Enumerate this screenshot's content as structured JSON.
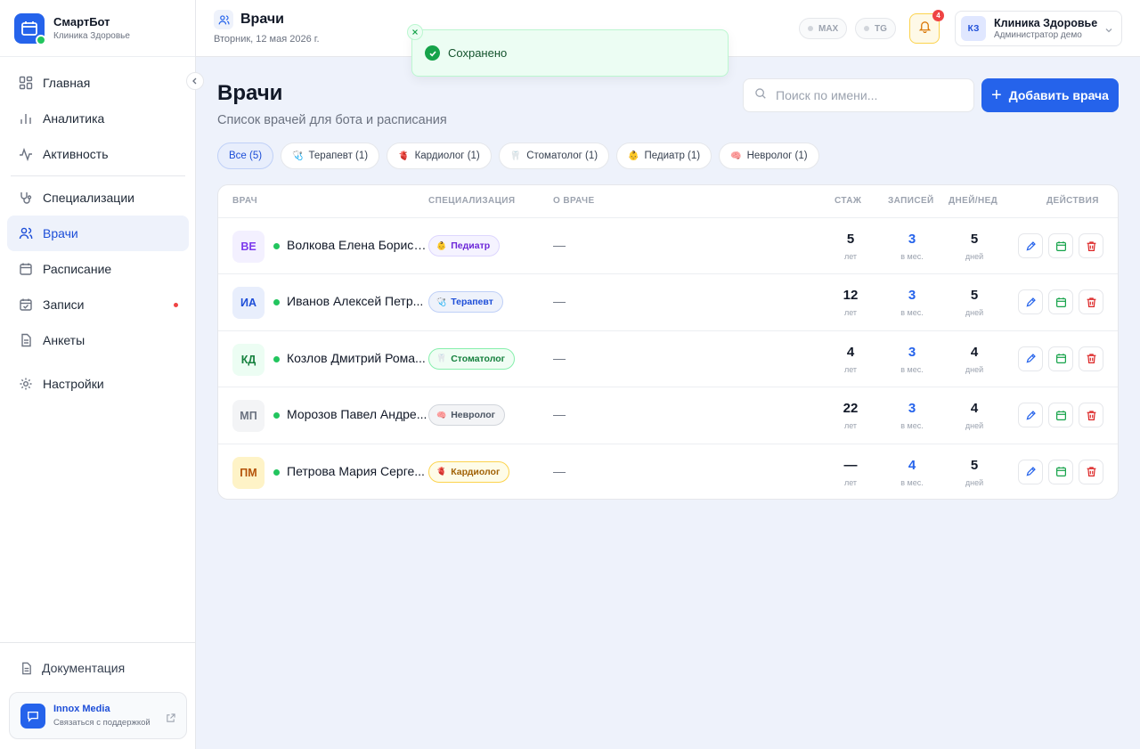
{
  "brand": {
    "name": "СмартБот",
    "subtitle": "Клиника Здоровье"
  },
  "nav": {
    "items": [
      {
        "label": "Главная",
        "icon": "grid-icon"
      },
      {
        "label": "Аналитика",
        "icon": "bar-chart-icon"
      },
      {
        "label": "Активность",
        "icon": "pulse-icon"
      },
      {
        "label": "Специализации",
        "icon": "stethoscope-icon"
      },
      {
        "label": "Врачи",
        "icon": "users-icon",
        "active": true
      },
      {
        "label": "Расписание",
        "icon": "calendar-icon"
      },
      {
        "label": "Записи",
        "icon": "calendar-check-icon",
        "has_dot": true
      },
      {
        "label": "Анкеты",
        "icon": "document-icon"
      },
      {
        "label": "Настройки",
        "icon": "gear-icon"
      }
    ],
    "docs_label": "Документация",
    "support": {
      "title": "Innox Media",
      "subtitle": "Связаться с поддержкой"
    }
  },
  "header": {
    "title": "Врачи",
    "date": "Вторник, 12 мая 2026 г.",
    "channels": [
      "MAX",
      "TG"
    ],
    "notifications_count": "4",
    "account": {
      "initials": "КЗ",
      "name": "Клиника Здоровье",
      "role": "Администратор демо"
    }
  },
  "toast": {
    "text": "Сохранено"
  },
  "page": {
    "title": "Врачи",
    "subtitle": "Список врачей для бота и расписания",
    "search_placeholder": "Поиск по имени...",
    "add_button": "Добавить врача"
  },
  "filters": [
    {
      "label": "Все (5)",
      "active": true,
      "emoji": ""
    },
    {
      "label": "Терапевт (1)",
      "emoji": "🩺"
    },
    {
      "label": "Кардиолог (1)",
      "emoji": "🫀"
    },
    {
      "label": "Стоматолог (1)",
      "emoji": "🦷"
    },
    {
      "label": "Педиатр (1)",
      "emoji": "👶"
    },
    {
      "label": "Невролог (1)",
      "emoji": "🧠"
    }
  ],
  "table": {
    "headers": {
      "doctor": "ВРАЧ",
      "spec": "СПЕЦИАЛИЗАЦИЯ",
      "about": "О ВРАЧЕ",
      "exp": "СТАЖ",
      "bookings": "ЗАПИСЕЙ",
      "days": "ДНЕЙ/НЕД",
      "actions": "ДЕЙСТВИЯ"
    },
    "rows": [
      {
        "initials": "ВЕ",
        "name": "Волкова Елена Борисо...",
        "spec": "Педиатр",
        "spec_emoji": "👶",
        "about": "—",
        "exp": "5",
        "exp_unit": "лет",
        "bookings": "3",
        "bookings_unit": "в мес.",
        "days": "5",
        "days_unit": "дней",
        "avatar_bg": "#f3f0ff",
        "avatar_fg": "#7c3aed",
        "spec_bg": "#f5f3ff",
        "spec_border": "#ddd6fe",
        "spec_fg": "#6d28d9"
      },
      {
        "initials": "ИА",
        "name": "Иванов Алексей Петр...",
        "spec": "Терапевт",
        "spec_emoji": "🩺",
        "about": "—",
        "exp": "12",
        "exp_unit": "лет",
        "bookings": "3",
        "bookings_unit": "в мес.",
        "days": "5",
        "days_unit": "дней",
        "avatar_bg": "#e8eefc",
        "avatar_fg": "#1d4ed8",
        "spec_bg": "#eef2fb",
        "spec_border": "#bfd0f7",
        "spec_fg": "#1d4ed8"
      },
      {
        "initials": "КД",
        "name": "Козлов Дмитрий Рома...",
        "spec": "Стоматолог",
        "spec_emoji": "🦷",
        "about": "—",
        "exp": "4",
        "exp_unit": "лет",
        "bookings": "3",
        "bookings_unit": "в мес.",
        "days": "4",
        "days_unit": "дней",
        "avatar_bg": "#ecfdf3",
        "avatar_fg": "#15803d",
        "spec_bg": "#f0fdf4",
        "spec_border": "#86efac",
        "spec_fg": "#15803d"
      },
      {
        "initials": "МП",
        "name": "Морозов Павел Андре...",
        "spec": "Невролог",
        "spec_emoji": "🧠",
        "about": "—",
        "exp": "22",
        "exp_unit": "лет",
        "bookings": "3",
        "bookings_unit": "в мес.",
        "days": "4",
        "days_unit": "дней",
        "avatar_bg": "#f3f4f6",
        "avatar_fg": "#6b7280",
        "spec_bg": "#f3f4f6",
        "spec_border": "#d1d5db",
        "spec_fg": "#4b5563"
      },
      {
        "initials": "ПМ",
        "name": "Петрова Мария Серге...",
        "spec": "Кардиолог",
        "spec_emoji": "🫀",
        "about": "—",
        "exp": "—",
        "exp_unit": "лет",
        "bookings": "4",
        "bookings_unit": "в мес.",
        "days": "5",
        "days_unit": "дней",
        "avatar_bg": "#fef3c7",
        "avatar_fg": "#b45309",
        "spec_bg": "#fefce8",
        "spec_border": "#fcd34d",
        "spec_fg": "#a16207"
      }
    ],
    "actions": [
      {
        "name": "edit-button",
        "icon": "pencil-icon",
        "color": "#2563eb"
      },
      {
        "name": "schedule-button",
        "icon": "calendar-icon",
        "color": "#16a34a"
      },
      {
        "name": "delete-button",
        "icon": "trash-icon",
        "color": "#dc2626"
      }
    ]
  }
}
